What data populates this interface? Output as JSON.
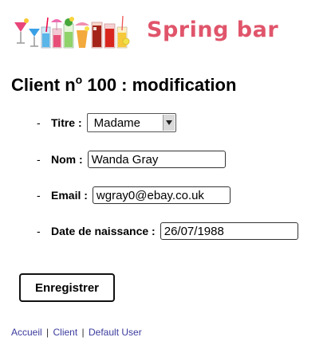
{
  "site": {
    "brand": "Spring bar"
  },
  "page": {
    "title_main": "Client n",
    "title_sup": "o",
    "title_rest": " 100 : modification"
  },
  "form": {
    "titre": {
      "label": "Titre :",
      "value": "Madame",
      "icon": "chevron-down-icon"
    },
    "nom": {
      "label": "Nom :",
      "value": "Wanda Gray"
    },
    "email": {
      "label": "Email :",
      "value": "wgray0@ebay.co.uk"
    },
    "dob": {
      "label": "Date de naissance :",
      "value": "26/07/1988"
    },
    "submit_label": "Enregistrer"
  },
  "footer": {
    "links": [
      "Accueil",
      "Client",
      "Default User"
    ],
    "separator": "|"
  },
  "colors": {
    "brand": "#e0556b",
    "link": "#3b3b9e"
  }
}
